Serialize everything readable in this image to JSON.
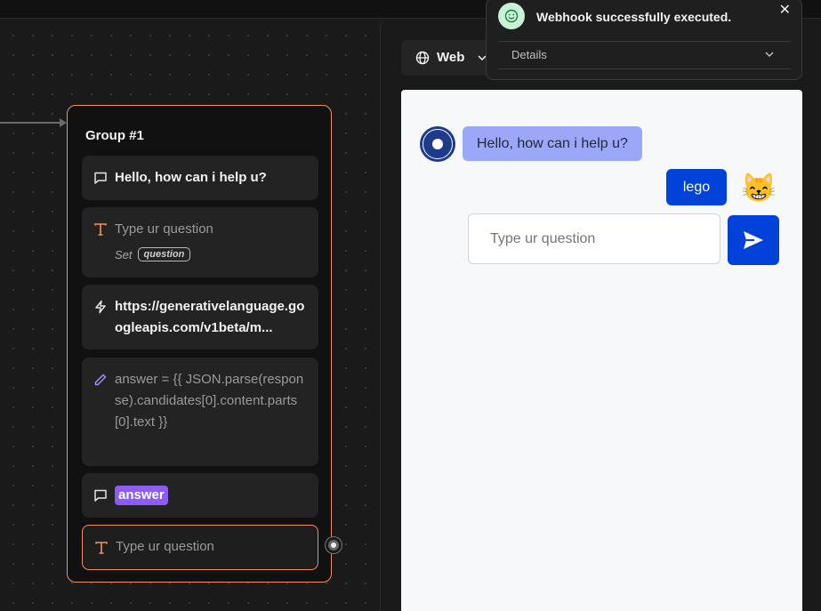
{
  "editor": {
    "group": {
      "title": "Group #1",
      "blocks": [
        {
          "type": "text-bubble",
          "icon": "chat-bubble-icon",
          "text": "Hello, how can i help u?"
        },
        {
          "type": "text-input",
          "icon": "text-input-icon",
          "text": "Type ur question",
          "set_label": "Set",
          "variable": "question"
        },
        {
          "type": "webhook",
          "icon": "lightning-icon",
          "text": "https://generativelanguage.googleapis.com/v1beta/m..."
        },
        {
          "type": "set-variable",
          "icon": "pencil-icon",
          "text": "answer = {{ JSON.parse(response).candidates[0].content.parts[0].text }}"
        },
        {
          "type": "text-bubble",
          "icon": "chat-bubble-icon",
          "variable": "answer"
        },
        {
          "type": "text-input",
          "icon": "text-input-icon",
          "text": "Type ur question"
        }
      ]
    }
  },
  "preview": {
    "mode_label": "Web",
    "bot_message": "Hello, how can i help u?",
    "user_message": "lego",
    "user_avatar": "😸",
    "input_placeholder": "Type ur question"
  },
  "toast": {
    "message": "Webhook successfully executed.",
    "details_label": "Details",
    "close_glyph": "✕"
  },
  "colors": {
    "group_border": "#f0935a",
    "variable_badge": "#8b5cf6",
    "chat_accent": "#0042da",
    "bot_bubble": "#9aa8f7"
  }
}
